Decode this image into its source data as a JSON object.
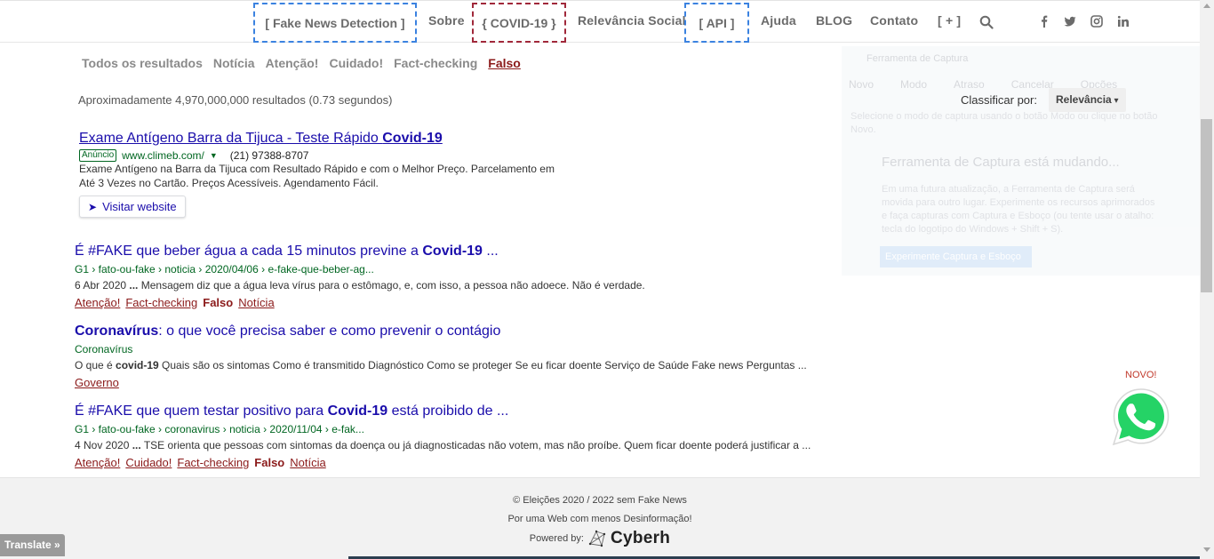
{
  "nav": {
    "fake_news_detection": "[ Fake News Detection ]",
    "sobre": "Sobre",
    "covid": "{ COVID-19 }",
    "relevancia": "Relevância Social",
    "api": "[ API ]",
    "ajuda": "Ajuda",
    "blog": "BLOG",
    "contato": "Contato",
    "more": "[ + ]",
    "colors": {
      "blue_box": "#3b82e0",
      "red_box": "#a0283a"
    }
  },
  "social_icons": [
    "facebook-icon",
    "twitter-icon",
    "instagram-icon",
    "linkedin-icon"
  ],
  "filters": {
    "tabs": [
      "Todos os resultados",
      "Notícia",
      "Atenção!",
      "Cuidado!",
      "Fact-checking",
      "Falso"
    ],
    "active": "Falso"
  },
  "result_count": "Aproximadamente 4,970,000,000 resultados (0.73 segundos)",
  "sort": {
    "label": "Classificar por:",
    "value": "Relevância"
  },
  "ad": {
    "title_pre": "Exame Antígeno Barra da Tijuca - Teste Rápido ",
    "title_bold": "Covid-19",
    "badge": "Anúncio",
    "url": "www.climeb.com/",
    "phone": "(21) 97388-8707",
    "desc1": "Exame Antígeno na Barra da Tijuca com Resultado Rápido e com o Melhor Preço. Parcelamento em",
    "desc2": "Até 3 Vezes no Cartão. Preços Acessíveis. Agendamento Fácil.",
    "visit": "Visitar website"
  },
  "results": [
    {
      "title_pre": "É #FAKE que beber água a cada 15 minutos previne a ",
      "title_bold": "Covid-19",
      "title_post": " ...",
      "url": "G1 › fato-ou-fake › noticia › 2020/04/06 › e-fake-que-beber-ag...",
      "snippet_pre": "6 Abr 2020 ",
      "snippet_bold": "...",
      "snippet_post": " Mensagem diz que a água leva vírus para o estômago, e, com isso, a pessoa não adoece. Não é verdade.",
      "tags": [
        "Atenção!",
        "Fact-checking",
        "Falso",
        "Notícia"
      ]
    },
    {
      "title_pre": "",
      "title_bold": "Coronavírus",
      "title_post": ": o que você precisa saber e como prevenir o contágio",
      "url": "Coronavírus",
      "snippet_pre": "O que é ",
      "snippet_bold": "covid-19",
      "snippet_post": " Quais são os sintomas Como é transmitido Diagnóstico Como se proteger Se eu ficar doente Serviço de Saúde Fake news Perguntas ...",
      "tags": [
        "Governo"
      ]
    },
    {
      "title_pre": "É #FAKE que quem testar positivo para ",
      "title_bold": "Covid-19",
      "title_post": " está proibido de ...",
      "url": "G1 › fato-ou-fake › coronavirus › noticia › 2020/11/04 › e-fak...",
      "snippet_pre": "4 Nov 2020 ",
      "snippet_bold": "...",
      "snippet_post": " TSE orienta que pessoas com sintomas da doença ou já diagnosticadas não votem, mas não proíbe. Quem ficar doente poderá justificar a ...",
      "tags": [
        "Atenção!",
        "Cuidado!",
        "Fact-checking",
        "Falso",
        "Notícia"
      ]
    }
  ],
  "snip_overlay": {
    "title": "Ferramenta de Captura",
    "toolbar": [
      "Novo",
      "Modo",
      "Atraso",
      "Cancelar",
      "Opções"
    ],
    "text": "Selecione o modo de captura usando o botão Modo ou clique no botão Novo.",
    "head": "Ferramenta de Captura está mudando...",
    "body": "Em uma futura atualização, a Ferramenta de Captura será movida para outro lugar. Experimente os recursos aprimorados e faça capturas com Captura e Esboço (ou tente usar o atalho: tecla do logotipo do Windows + Shift + S).",
    "button": "Experimente Captura e Esboço"
  },
  "whatsapp": {
    "novo": "NOVO!",
    "color": "#25d366"
  },
  "footer": {
    "line1": "© Eleições 2020 / 2022 sem Fake News",
    "line2": "Por uma Web com menos Desinformação!",
    "powered": "Powered by:",
    "brand": "Cyberh"
  },
  "translate": "Translate »"
}
